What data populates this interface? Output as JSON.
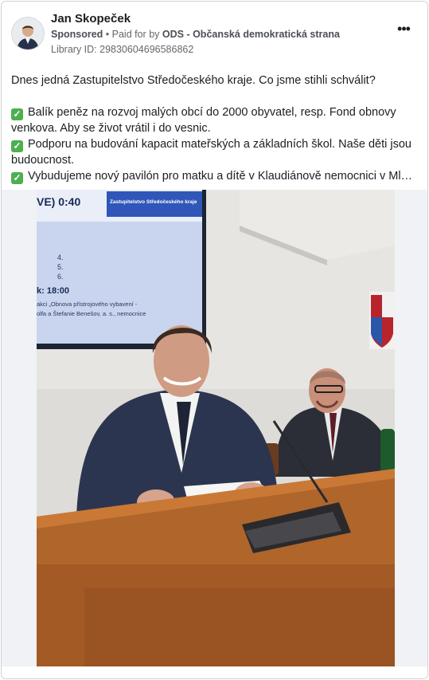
{
  "post": {
    "author": "Jan Skopeček",
    "sponsored_label": "Sponsored",
    "paid_for_prefix": "Paid for by",
    "paid_for_by": "ODS - Občanská demokratická strana",
    "library_id": "Library ID: 29830604696586862",
    "text": {
      "intro": "Dnes jedná Zastupitelstvo Středočeského kraje. Co jsme stihli schválit?",
      "items": [
        "Balík peněz na rozvoj malých obcí do 2000 obyvatel, resp. Fond obnovy venkova. Aby se život vrátil i do vesnic.",
        "Podporu na budování kapacit mateřských a základních škol. Naše děti jsou budoucnost.",
        "Vybudujeme nový pavilón pro matku a dítě v Klaudiánově nemocnici v Mladé Boleslavi."
      ]
    },
    "photo": {
      "screen_header": "Zastupitelstvo Středočeského kraje",
      "screen_time1": "VE) 0:40",
      "screen_nums": [
        "4.",
        "5.",
        "6."
      ],
      "screen_time2": "k: 18:00",
      "screen_line1": "akci „Obnova přístrojového vybavení -",
      "screen_line2": "olfa a Štefanie Benešov, a. s., nemocnice"
    }
  },
  "icons": {
    "more": "more-options-icon",
    "check": "check-mark-icon"
  },
  "colors": {
    "check_green": "#4caf50",
    "meta_gray": "#65676b",
    "screen_blue": "#2f56b8"
  }
}
